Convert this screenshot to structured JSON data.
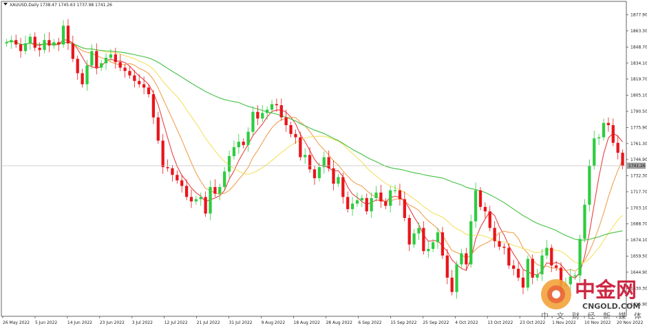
{
  "chart_data": {
    "type": "candlestick",
    "symbol_line": {
      "symbol": "XAUUSD,Daily",
      "ohlc": "1738.47 1745.63 1737.98 1741.26"
    },
    "current_price_label": "1741.26",
    "ylim": [
      1605,
      1890
    ],
    "y_ticks": [
      "1877.90",
      "1863.30",
      "1848.70",
      "1834.10",
      "1819.70",
      "1805.10",
      "1790.50",
      "1775.90",
      "1761.30",
      "1746.90",
      "1732.30",
      "1717.70",
      "1703.10",
      "1688.70",
      "1674.10",
      "1659.50",
      "1644.90",
      "1630.30",
      "1615.90"
    ],
    "x_ticks": [
      "26 May 2022",
      "5 Jun 2022",
      "14 Jun 2022",
      "23 Jun 2022",
      "3 Jul 2022",
      "12 Jul 2022",
      "21 Jul 2022",
      "31 Jul 2022",
      "9 Aug 2022",
      "18 Aug 2022",
      "28 Aug 2022",
      "6 Sep 2022",
      "15 Sep 2022",
      "25 Sep 2022",
      "4 Oct 2022",
      "13 Oct 2022",
      "23 Oct 2022",
      "1 Nov 2022",
      "10 Nov 2022",
      "20 Nov 2022"
    ],
    "candles_close": [
      1853,
      1855,
      1851,
      1845,
      1852,
      1858,
      1848,
      1846,
      1855,
      1850,
      1853,
      1851,
      1868,
      1852,
      1838,
      1825,
      1815,
      1832,
      1845,
      1830,
      1834,
      1839,
      1842,
      1835,
      1830,
      1827,
      1823,
      1818,
      1815,
      1812,
      1806,
      1785,
      1764,
      1740,
      1739,
      1733,
      1728,
      1723,
      1713,
      1709,
      1711,
      1713,
      1698,
      1722,
      1716,
      1722,
      1736,
      1750,
      1758,
      1763,
      1760,
      1772,
      1790,
      1784,
      1789,
      1792,
      1797,
      1796,
      1785,
      1778,
      1770,
      1767,
      1749,
      1751,
      1738,
      1730,
      1740,
      1749,
      1739,
      1725,
      1731,
      1713,
      1702,
      1707,
      1710,
      1712,
      1700,
      1712,
      1717,
      1709,
      1705,
      1719,
      1719,
      1711,
      1694,
      1670,
      1680,
      1685,
      1664,
      1666,
      1672,
      1681,
      1660,
      1640,
      1627,
      1652,
      1662,
      1652,
      1691,
      1719,
      1704,
      1700,
      1685,
      1673,
      1668,
      1667,
      1651,
      1648,
      1640,
      1631,
      1657,
      1640,
      1643,
      1660,
      1667,
      1651,
      1649,
      1632,
      1634,
      1641,
      1642,
      1675,
      1706,
      1741,
      1766,
      1767,
      1780,
      1778,
      1762,
      1753,
      1741
    ],
    "candles_open": [
      1852,
      1853,
      1855,
      1851,
      1845,
      1852,
      1858,
      1848,
      1846,
      1855,
      1850,
      1853,
      1851,
      1868,
      1852,
      1838,
      1825,
      1815,
      1832,
      1845,
      1830,
      1834,
      1839,
      1842,
      1835,
      1830,
      1827,
      1823,
      1818,
      1815,
      1812,
      1806,
      1785,
      1764,
      1740,
      1739,
      1733,
      1728,
      1723,
      1713,
      1709,
      1711,
      1713,
      1698,
      1722,
      1716,
      1722,
      1736,
      1750,
      1758,
      1763,
      1760,
      1772,
      1790,
      1784,
      1789,
      1792,
      1797,
      1796,
      1785,
      1778,
      1770,
      1767,
      1749,
      1751,
      1738,
      1730,
      1740,
      1749,
      1739,
      1725,
      1731,
      1713,
      1702,
      1707,
      1710,
      1712,
      1700,
      1712,
      1717,
      1709,
      1705,
      1719,
      1719,
      1711,
      1694,
      1670,
      1680,
      1685,
      1664,
      1666,
      1672,
      1681,
      1660,
      1640,
      1627,
      1652,
      1662,
      1652,
      1691,
      1719,
      1704,
      1700,
      1685,
      1673,
      1668,
      1667,
      1651,
      1648,
      1640,
      1631,
      1657,
      1640,
      1643,
      1660,
      1667,
      1651,
      1649,
      1632,
      1634,
      1641,
      1642,
      1675,
      1706,
      1741,
      1766,
      1767,
      1780,
      1778,
      1762,
      1753
    ],
    "series": [
      {
        "color": "#e84040",
        "period": 5
      },
      {
        "color": "#f0a050",
        "period": 10
      },
      {
        "color": "#f4e060",
        "period": 20
      },
      {
        "color": "#40c040",
        "period": 50
      }
    ],
    "colors": {
      "bull": "#2ecc40",
      "bear": "#e8151b",
      "grid": "#d9d9d9",
      "axis": "#222222",
      "price_line": "#c0c0c0"
    }
  },
  "watermark": {
    "brand_cn": "中金网",
    "brand_en": "CNGOLD.COM",
    "slogan_cn": "中 文 财 经 新 媒 体"
  }
}
